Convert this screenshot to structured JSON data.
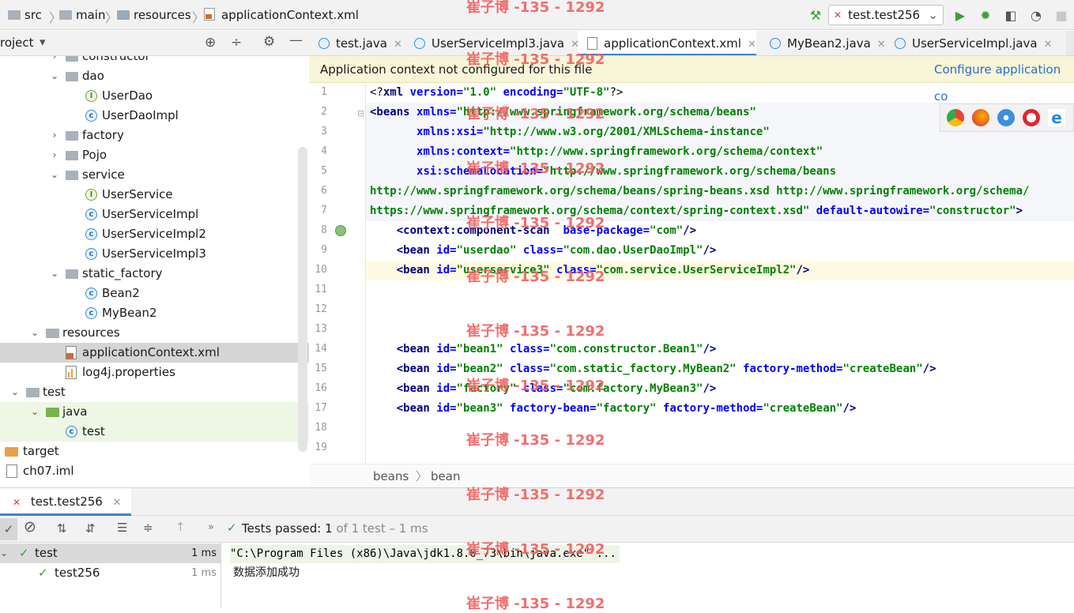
{
  "breadcrumb": [
    "src",
    "main",
    "resources",
    "applicationContext.xml"
  ],
  "run_config": "test.test256",
  "project_panel": {
    "title": "roject"
  },
  "tree": [
    {
      "label": "constructor",
      "kind": "package",
      "depth": 3,
      "arrow": "›"
    },
    {
      "label": "dao",
      "kind": "package",
      "depth": 3,
      "arrow": "⌄"
    },
    {
      "label": "UserDao",
      "kind": "interface",
      "depth": 4,
      "arrow": ""
    },
    {
      "label": "UserDaoImpl",
      "kind": "class",
      "depth": 4,
      "arrow": ""
    },
    {
      "label": "factory",
      "kind": "package",
      "depth": 3,
      "arrow": "›"
    },
    {
      "label": "Pojo",
      "kind": "package",
      "depth": 3,
      "arrow": "›"
    },
    {
      "label": "service",
      "kind": "package",
      "depth": 3,
      "arrow": "⌄"
    },
    {
      "label": "UserService",
      "kind": "interface",
      "depth": 4,
      "arrow": ""
    },
    {
      "label": "UserServiceImpl",
      "kind": "class",
      "depth": 4,
      "arrow": ""
    },
    {
      "label": "UserServiceImpl2",
      "kind": "class",
      "depth": 4,
      "arrow": ""
    },
    {
      "label": "UserServiceImpl3",
      "kind": "class",
      "depth": 4,
      "arrow": ""
    },
    {
      "label": "static_factory",
      "kind": "package",
      "depth": 3,
      "arrow": "⌄"
    },
    {
      "label": "Bean2",
      "kind": "class",
      "depth": 4,
      "arrow": ""
    },
    {
      "label": "MyBean2",
      "kind": "class",
      "depth": 4,
      "arrow": ""
    },
    {
      "label": "resources",
      "kind": "resfolder",
      "depth": 2,
      "arrow": "⌄"
    },
    {
      "label": "applicationContext.xml",
      "kind": "xml",
      "depth": 3,
      "arrow": "",
      "selected": true
    },
    {
      "label": "log4j.properties",
      "kind": "props",
      "depth": 3,
      "arrow": ""
    },
    {
      "label": "test",
      "kind": "folder",
      "depth": 1,
      "arrow": "⌄"
    },
    {
      "label": "java",
      "kind": "testfolder",
      "depth": 2,
      "arrow": "⌄",
      "green": true
    },
    {
      "label": "test",
      "kind": "testclass",
      "depth": 3,
      "arrow": "",
      "green": true
    },
    {
      "label": "target",
      "kind": "orange",
      "depth": 0,
      "arrow": ""
    },
    {
      "label": "ch07.iml",
      "kind": "iml",
      "depth": 0,
      "arrow": ""
    }
  ],
  "tabs": [
    {
      "label": "test.java",
      "active": false
    },
    {
      "label": "UserServiceImpl3.java",
      "active": false
    },
    {
      "label": "applicationContext.xml",
      "active": true
    },
    {
      "label": "MyBean2.java",
      "active": false
    },
    {
      "label": "UserServiceImpl.java",
      "active": false
    }
  ],
  "banner": {
    "message": "Application context not configured for this file",
    "action": "Configure application co"
  },
  "code_lines": [
    [
      [
        "pl",
        "<?"
      ],
      [
        "tg",
        "xml "
      ],
      [
        "at",
        "version="
      ],
      [
        "st",
        "\"1.0\" "
      ],
      [
        "at",
        "encoding="
      ],
      [
        "st",
        "\"UTF-8\""
      ],
      [
        "pl",
        "?>"
      ]
    ],
    [
      [
        "tg",
        "<beans "
      ],
      [
        "at",
        "xmlns="
      ],
      [
        "st",
        "\"http://www.springframework.org/schema/beans\""
      ]
    ],
    [
      [
        "pl",
        "       "
      ],
      [
        "at",
        "xmlns:xsi="
      ],
      [
        "st",
        "\"http://www.w3.org/2001/XMLSchema-instance\""
      ]
    ],
    [
      [
        "pl",
        "       "
      ],
      [
        "at",
        "xmlns:context="
      ],
      [
        "st",
        "\"http://www.springframework.org/schema/context\""
      ]
    ],
    [
      [
        "pl",
        "       "
      ],
      [
        "at",
        "xsi:schemaLocation="
      ],
      [
        "st",
        "\"http://www.springframework.org/schema/beans"
      ]
    ],
    [
      [
        "st",
        "http://www.springframework.org/schema/beans/spring-beans.xsd http://www.springframework.org/schema/"
      ]
    ],
    [
      [
        "st",
        "https://www.springframework.org/schema/context/spring-context.xsd\" "
      ],
      [
        "at",
        "default-autowire="
      ],
      [
        "st",
        "\"constructor\""
      ],
      [
        "tg",
        ">"
      ]
    ],
    [
      [
        "pl",
        "    "
      ],
      [
        "tg",
        "<context:component-scan  "
      ],
      [
        "at",
        "base-package="
      ],
      [
        "st",
        "\"com\""
      ],
      [
        "tg",
        "/>"
      ]
    ],
    [
      [
        "pl",
        "    "
      ],
      [
        "tg",
        "<bean "
      ],
      [
        "at",
        "id="
      ],
      [
        "st",
        "\"userdao\" "
      ],
      [
        "at",
        "class="
      ],
      [
        "st",
        "\"com.dao.UserDaoImpl\""
      ],
      [
        "tg",
        "/>"
      ]
    ],
    [
      [
        "pl",
        "    "
      ],
      [
        "tg",
        "<bean "
      ],
      [
        "at",
        "id="
      ],
      [
        "st",
        "\"userservice3\" "
      ],
      [
        "at",
        "class="
      ],
      [
        "st",
        "\"com.service.UserServiceImpl2\""
      ],
      [
        "tg",
        "/>"
      ]
    ],
    [],
    [],
    [],
    [
      [
        "pl",
        "    "
      ],
      [
        "tg",
        "<bean "
      ],
      [
        "at",
        "id="
      ],
      [
        "st",
        "\"bean1\" "
      ],
      [
        "at",
        "class="
      ],
      [
        "st",
        "\"com.constructor.Bean1\""
      ],
      [
        "tg",
        "/>"
      ]
    ],
    [
      [
        "pl",
        "    "
      ],
      [
        "tg",
        "<bean "
      ],
      [
        "at",
        "id="
      ],
      [
        "st",
        "\"bean2\" "
      ],
      [
        "at",
        "class="
      ],
      [
        "st",
        "\"com.static_factory.MyBean2\" "
      ],
      [
        "at",
        "factory-method="
      ],
      [
        "st",
        "\"createBean\""
      ],
      [
        "tg",
        "/>"
      ]
    ],
    [
      [
        "pl",
        "    "
      ],
      [
        "tg",
        "<bean "
      ],
      [
        "at",
        "id="
      ],
      [
        "st",
        "\"factory\" "
      ],
      [
        "at",
        "class="
      ],
      [
        "st",
        "\"com.factory.MyBean3\""
      ],
      [
        "tg",
        "/>"
      ]
    ],
    [
      [
        "pl",
        "    "
      ],
      [
        "tg",
        "<bean "
      ],
      [
        "at",
        "id="
      ],
      [
        "st",
        "\"bean3\" "
      ],
      [
        "at",
        "factory-bean="
      ],
      [
        "st",
        "\"factory\" "
      ],
      [
        "at",
        "factory-method="
      ],
      [
        "st",
        "\"createBean\""
      ],
      [
        "tg",
        "/>"
      ]
    ],
    [],
    []
  ],
  "line_numbers": [
    "1",
    "2",
    "3",
    "4",
    "5",
    "6",
    "7",
    "8",
    "9",
    "10",
    "11",
    "12",
    "13",
    "14",
    "15",
    "16",
    "17",
    "18",
    "19"
  ],
  "editor_breadcrumb": [
    "beans",
    "bean"
  ],
  "bottom_tab": "test.test256",
  "test_status": {
    "passed_label": "Tests passed:",
    "count": "1",
    "rest": "of 1 test – 1 ms"
  },
  "test_tree": [
    {
      "label": "test",
      "time": "1 ms"
    },
    {
      "label": "test256",
      "time": "1 ms"
    }
  ],
  "console": {
    "command": "\"C:\\Program Files (x86)\\Java\\jdk1.8.0_73\\bin\\java.exe\" ...",
    "output": "数据添加成功"
  },
  "watermark": "崔子博 -135 - 1292",
  "colors": {
    "tag": "#000080",
    "attr": "#0000ff",
    "string": "#008000",
    "accent": "#4083c9",
    "pass": "#3a9c3a"
  }
}
